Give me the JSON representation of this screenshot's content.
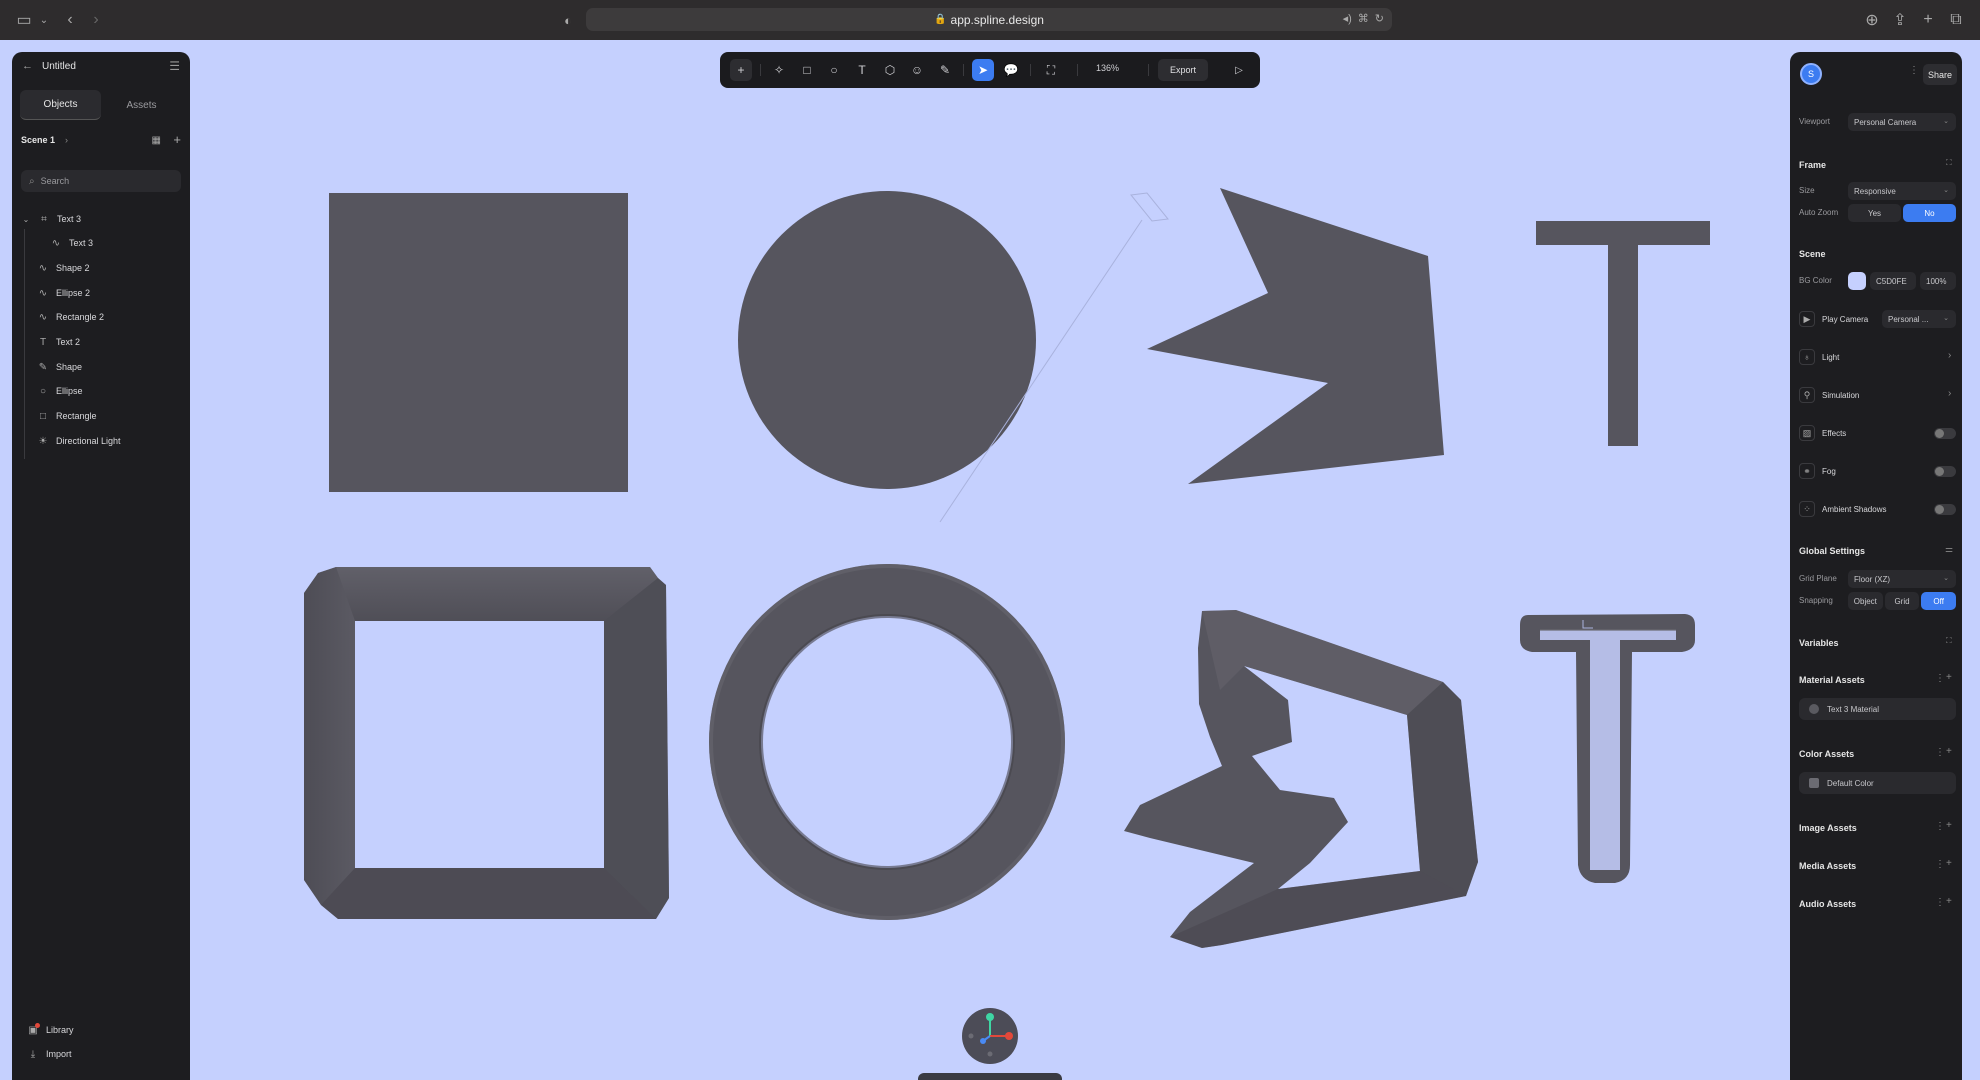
{
  "browser": {
    "url": "app.spline.design"
  },
  "left_panel": {
    "file_title": "Untitled",
    "tabs": [
      {
        "label": "Objects",
        "active": true
      },
      {
        "label": "Assets",
        "active": false
      }
    ],
    "scene_label": "Scene 1",
    "search_placeholder": "Search",
    "tree": [
      {
        "label": "Text 3",
        "icon": "group-icon"
      },
      {
        "label": "Text 3",
        "icon": "path-icon"
      },
      {
        "label": "Shape 2",
        "icon": "path-icon"
      },
      {
        "label": "Ellipse 2",
        "icon": "path-icon"
      },
      {
        "label": "Rectangle 2",
        "icon": "path-icon"
      },
      {
        "label": "Text 2",
        "icon": "text-icon"
      },
      {
        "label": "Shape",
        "icon": "shape-icon"
      },
      {
        "label": "Ellipse",
        "icon": "ellipse-icon"
      },
      {
        "label": "Rectangle",
        "icon": "rectangle-icon"
      },
      {
        "label": "Directional Light",
        "icon": "light-icon"
      }
    ],
    "footer": [
      {
        "label": "Library",
        "icon": "library-icon"
      },
      {
        "label": "Import",
        "icon": "import-icon"
      }
    ]
  },
  "toolbar": {
    "zoom": "136%",
    "export_label": "Export"
  },
  "right_panel": {
    "avatar_letter": "S",
    "share_label": "Share",
    "viewport_label": "Viewport",
    "viewport_value": "Personal Camera",
    "frame_title": "Frame",
    "size_label": "Size",
    "size_value": "Responsive",
    "auto_zoom_label": "Auto Zoom",
    "auto_zoom_yes": "Yes",
    "auto_zoom_no": "No",
    "scene_title": "Scene",
    "bg_color_label": "BG Color",
    "bg_color_hex": "C5D0FE",
    "bg_color_opacity": "100%",
    "bg_color_value": "#C5D0FE",
    "play_camera_label": "Play Camera",
    "play_camera_value": "Personal ...",
    "light_label": "Light",
    "simulation_label": "Simulation",
    "effects_label": "Effects",
    "fog_label": "Fog",
    "ambient_shadows_label": "Ambient Shadows",
    "global_settings_title": "Global Settings",
    "grid_plane_label": "Grid Plane",
    "grid_plane_value": "Floor (XZ)",
    "snapping_label": "Snapping",
    "snapping_options": [
      "Object",
      "Grid",
      "Off"
    ],
    "variables_title": "Variables",
    "material_assets_title": "Material Assets",
    "material_item": "Text 3 Material",
    "color_assets_title": "Color Assets",
    "color_item": "Default Color",
    "image_assets_title": "Image Assets",
    "media_assets_title": "Media Assets",
    "audio_assets_title": "Audio Assets"
  },
  "colors": {
    "canvas_bg": "#C5D0FE",
    "shape_fill": "#56555E",
    "accent": "#3C7CF1"
  }
}
